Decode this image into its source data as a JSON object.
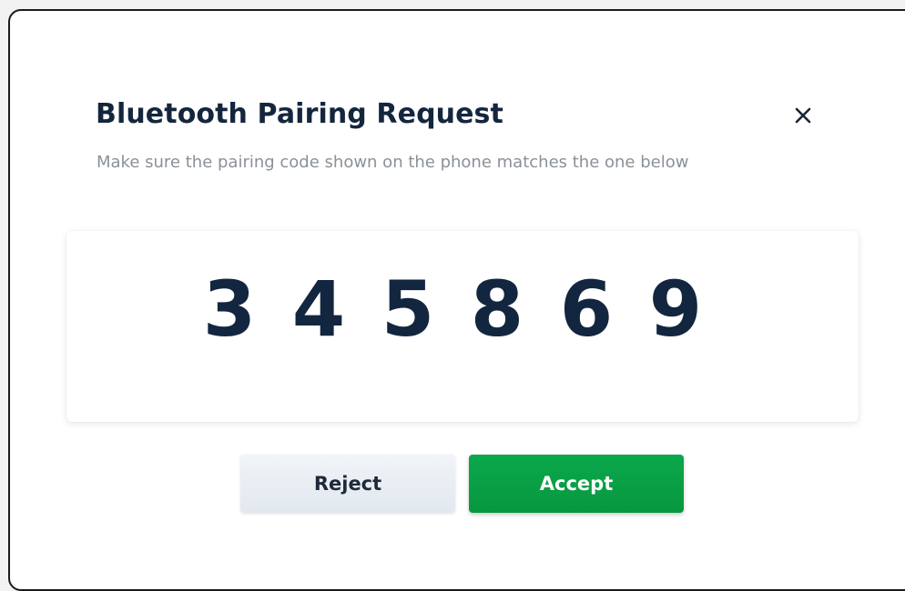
{
  "dialog": {
    "title": "Bluetooth Pairing Request",
    "subtitle": "Make sure the pairing code shown on the phone matches the one below",
    "close_icon": "close-icon",
    "pairing_code": [
      "3",
      "4",
      "5",
      "8",
      "6",
      "9"
    ]
  },
  "actions": {
    "reject_label": "Reject",
    "accept_label": "Accept"
  },
  "colors": {
    "title": "#14263d",
    "subtitle": "#8b9198",
    "accept": "#0aa84c",
    "reject": "#e6ebf1"
  }
}
